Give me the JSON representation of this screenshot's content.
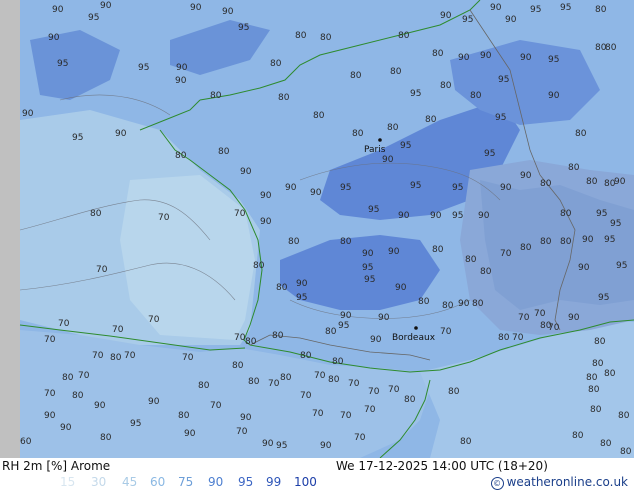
{
  "map": {
    "cities": [
      {
        "name": "Paris"
      },
      {
        "name": "Bordeaux"
      }
    ],
    "contour_labels": [
      "60",
      "70",
      "80",
      "90",
      "95"
    ]
  },
  "footer": {
    "variable": "RH 2m [%] Arome",
    "datetime": "We 17-12-2025 14:00 UTC (18+20)",
    "copyright": "weatheronline.co.uk",
    "legend": [
      {
        "label": "15",
        "color": "#d8e6f0"
      },
      {
        "label": "30",
        "color": "#c4d9ea"
      },
      {
        "label": "45",
        "color": "#a9cbe6"
      },
      {
        "label": "60",
        "color": "#8ab8e3"
      },
      {
        "label": "75",
        "color": "#6e9fd8"
      },
      {
        "label": "90",
        "color": "#4d7fd0"
      },
      {
        "label": "95",
        "color": "#3d66c4"
      },
      {
        "label": "99",
        "color": "#2d55b8"
      },
      {
        "label": "100",
        "color": "#1c3ea8"
      }
    ]
  }
}
